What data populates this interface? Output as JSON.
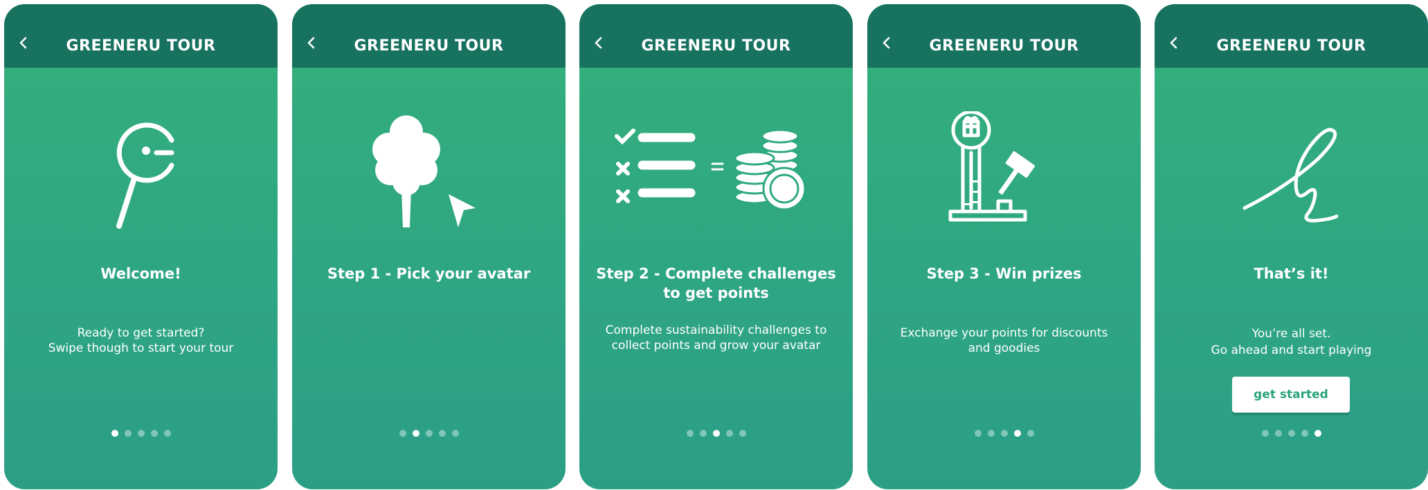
{
  "app_title": "GREENERU TOUR",
  "colors": {
    "header": "#177260",
    "card_top": "#35b07a",
    "card_bottom": "#2c9e86",
    "cta_text": "#2ca47b"
  },
  "screens": [
    {
      "heading": "Welcome!",
      "body_lines": [
        "Ready to get started?",
        "Swipe though to start your tour"
      ],
      "icon": "magnifier-g-icon",
      "active_dot": 1
    },
    {
      "heading": "Step 1 - Pick your avatar",
      "body_lines": [],
      "icon": "tree-cursor-icon",
      "active_dot": 2
    },
    {
      "heading_lines": [
        "Step 2 - Complete challenges",
        "to get points"
      ],
      "body_lines": [
        "Complete sustainability challenges to",
        "collect points and grow your avatar"
      ],
      "icon": "checklist-coins-icon",
      "active_dot": 3
    },
    {
      "heading": "Step 3 - Win prizes",
      "body_lines": [
        "Exchange your points for discounts",
        "and goodies"
      ],
      "icon": "strength-tester-icon",
      "active_dot": 4
    },
    {
      "heading": "That’s it!",
      "body_lines": [
        "You’re all set.",
        "Go ahead and start playing"
      ],
      "icon": "signature-icon",
      "active_dot": 5,
      "button_label": "get started"
    }
  ]
}
